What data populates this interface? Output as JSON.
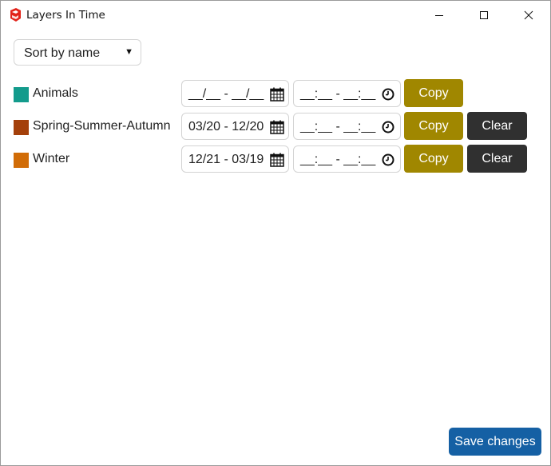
{
  "window": {
    "title": "Layers In Time",
    "controls": [
      "minimize-icon",
      "maximize-icon",
      "close-icon"
    ]
  },
  "sort": {
    "selected": "Sort by name",
    "caret": "▼"
  },
  "layers": [
    {
      "name": "Animals",
      "color": "#139b8c",
      "date_value": "__/__ - __/__",
      "time_value": "__:__ - __:__",
      "copy_label": "Copy",
      "clear_label": ""
    },
    {
      "name": "Spring-Summer-Autumn",
      "color": "#a4400b",
      "date_value": "03/20 - 12/20",
      "time_value": "__:__ - __:__",
      "copy_label": "Copy",
      "clear_label": "Clear"
    },
    {
      "name": "Winter",
      "color": "#d16c07",
      "date_value": "12/21 - 03/19",
      "time_value": "__:__ - __:__",
      "copy_label": "Copy",
      "clear_label": "Clear"
    }
  ],
  "icons": {
    "date": "calendar-icon",
    "time": "clock-icon",
    "app": "sketchup-logo-icon"
  },
  "footer": {
    "save_label": "Save changes"
  },
  "colors": {
    "copy_button": "#a08700",
    "clear_button": "#303030",
    "save_button": "#1560a4"
  }
}
